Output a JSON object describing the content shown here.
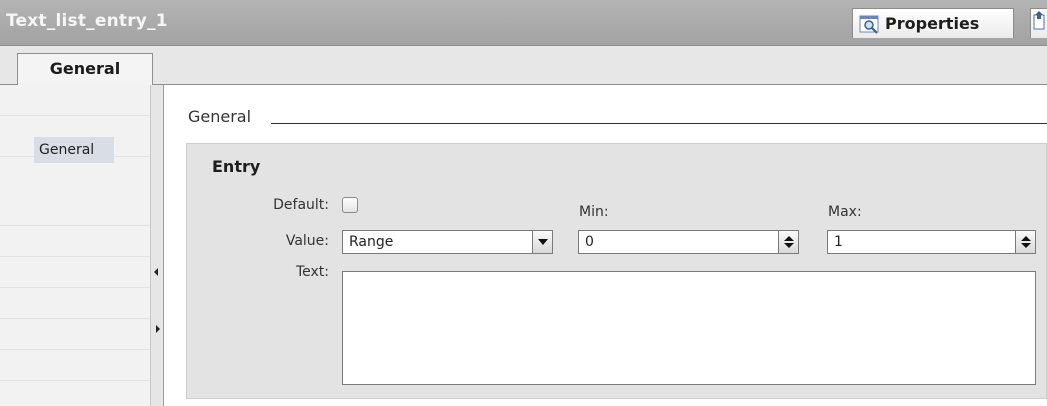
{
  "window": {
    "title": "Text_list_entry_1",
    "properties_tab_label": "Properties"
  },
  "tabs": [
    {
      "label": "General",
      "selected": true
    }
  ],
  "sidebar": {
    "items": [
      {
        "label": "General",
        "selected": true
      }
    ]
  },
  "main": {
    "section_title": "General",
    "group": {
      "title": "Entry",
      "default_label": "Default:",
      "default_checked": false,
      "value_label": "Value:",
      "value_selected": "Range",
      "min_label": "Min:",
      "min_value": "0",
      "max_label": "Max:",
      "max_value": "1",
      "text_label": "Text:",
      "text_value": ""
    }
  },
  "icons": {
    "properties_icon": "magnifier-properties-icon",
    "next_tab_icon": "pin-icon",
    "dropdown_icon": "chevron-down-icon",
    "spinner_icon": "spinner-updown-icon"
  },
  "colors": {
    "titlebar": "#a8a8a8",
    "title_text": "#f6f6f6",
    "group_background": "#e3e3e3",
    "selected_nav": "#d9dee6"
  }
}
